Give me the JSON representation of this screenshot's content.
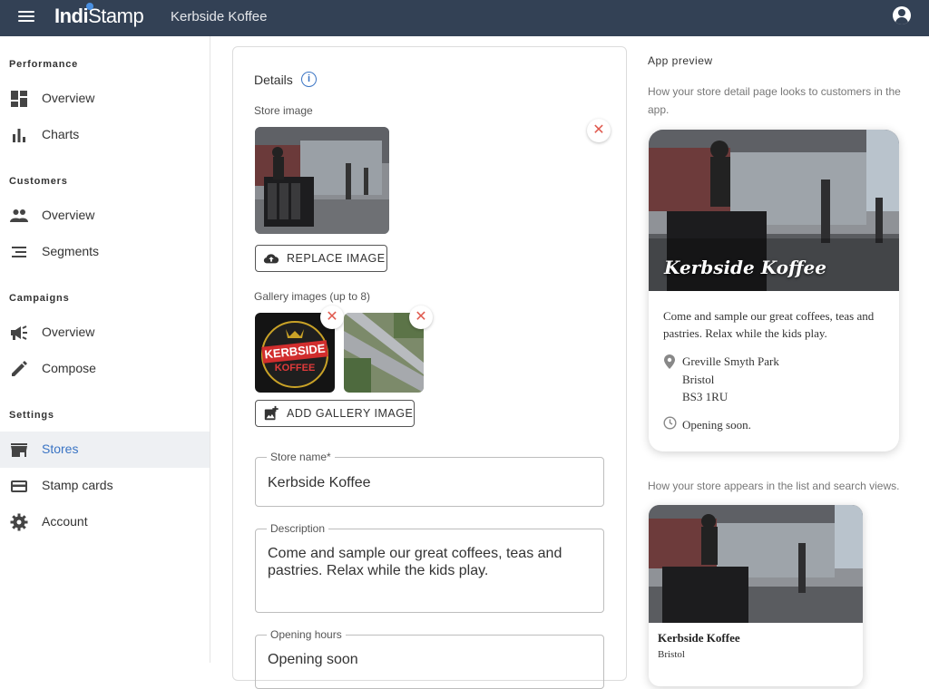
{
  "header": {
    "brand_indi": "Indi",
    "brand_stamp": "Stamp",
    "store_title": "Kerbside Koffee",
    "menu_icon": "menu-icon",
    "account_icon": "account-circle-icon",
    "bar_color": "#334155"
  },
  "sidebar": {
    "sections": [
      {
        "title": "Performance",
        "items": [
          {
            "label": "Overview",
            "icon": "dashboard-icon"
          },
          {
            "label": "Charts",
            "icon": "bar-chart-icon"
          }
        ]
      },
      {
        "title": "Customers",
        "items": [
          {
            "label": "Overview",
            "icon": "people-icon"
          },
          {
            "label": "Segments",
            "icon": "segments-icon"
          }
        ]
      },
      {
        "title": "Campaigns",
        "items": [
          {
            "label": "Overview",
            "icon": "megaphone-icon"
          },
          {
            "label": "Compose",
            "icon": "pencil-icon"
          }
        ]
      },
      {
        "title": "Settings",
        "items": [
          {
            "label": "Stores",
            "icon": "store-icon",
            "active": true
          },
          {
            "label": "Stamp cards",
            "icon": "card-icon"
          },
          {
            "label": "Account",
            "icon": "gear-icon"
          }
        ]
      }
    ],
    "active_color": "#3a74c4"
  },
  "form": {
    "details_title": "Details",
    "store_image_label": "Store image",
    "replace_image_label": "REPLACE IMAGE",
    "gallery_label": "Gallery images (up to 8)",
    "add_gallery_label": "ADD GALLERY IMAGE",
    "store_name_label": "Store name*",
    "store_name_value": "Kerbside Koffee",
    "description_label": "Description",
    "description_value": "Come and sample our great coffees, teas and pastries. Relax while the kids play.",
    "opening_hours_label": "Opening hours",
    "opening_hours_value": "Opening soon"
  },
  "preview": {
    "title": "App preview",
    "detail_desc": "How your store detail page looks to customers in the app.",
    "store_name": "Kerbside Koffee",
    "description": "Come and sample our great coffees, teas and pastries. Relax while the kids play.",
    "address_line1": "Greville Smyth Park",
    "address_line2": "Bristol",
    "address_line3": "BS3 1RU",
    "hours": "Opening soon.",
    "list_desc": "How your store appears in the list and search views.",
    "list_name": "Kerbside Koffee",
    "list_city": "Bristol"
  }
}
